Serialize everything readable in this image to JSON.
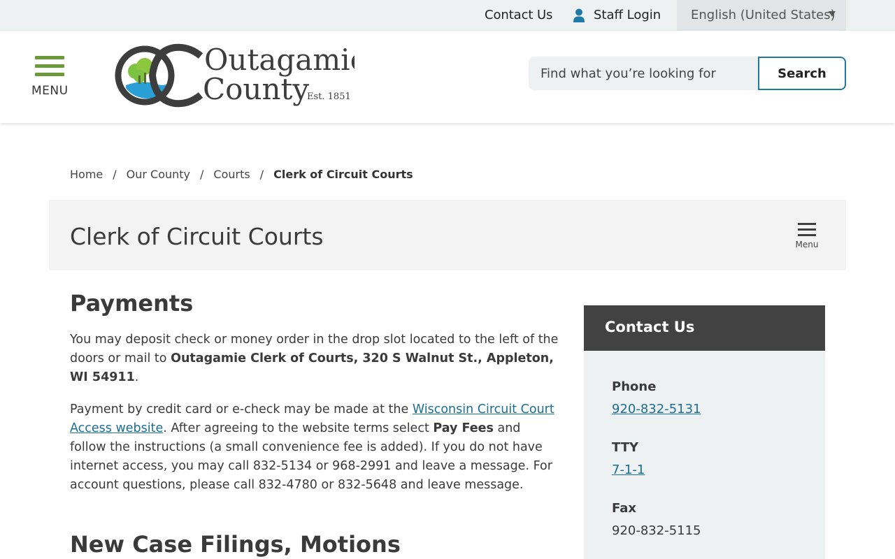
{
  "utility": {
    "contact": "Contact Us",
    "staff_login": "Staff Login",
    "language": "English (United States)"
  },
  "header": {
    "menu_label": "MENU",
    "logo_line1": "Outagamie",
    "logo_line2": "County",
    "logo_est": "Est. 1851",
    "search_placeholder": "Find what you’re looking for",
    "search_button": "Search"
  },
  "breadcrumb": {
    "items": [
      "Home",
      "Our County",
      "Courts"
    ],
    "current": "Clerk of Circuit Courts"
  },
  "page": {
    "title": "Clerk of Circuit Courts",
    "submenu_label": "Menu"
  },
  "content": {
    "heading1": "Payments",
    "p1_start": "You may deposit check or money order in the drop slot located to the left of the doors or mail to ",
    "p1_bold": "Outagamie Clerk of Courts, 320 S Walnut St., Appleton, WI 54911",
    "p1_end": ".",
    "p2_start": "Payment by credit card or e-check may be made at the ",
    "p2_link": "Wisconsin Circuit Court Access website",
    "p2_mid": ". After agreeing to the website terms select ",
    "p2_bold": "Pay Fees",
    "p2_end": " and follow the instructions (a small convenience fee is added). If you do not have internet access, you may call 832-5134 or 968-2991 and leave a message. For account questions, please call 832-4780 or 832-5648 and leave message.",
    "heading2": "New Case Filings, Motions"
  },
  "sidebar": {
    "title": "Contact Us",
    "phone_label": "Phone",
    "phone": "920-832-5131",
    "tty_label": "TTY",
    "tty": "7-1-1",
    "fax_label": "Fax",
    "fax": "920-832-5115"
  },
  "colors": {
    "accent_green": "#6a9a3a",
    "link_blue": "#1a6e96",
    "sidebar_header": "#424242"
  }
}
